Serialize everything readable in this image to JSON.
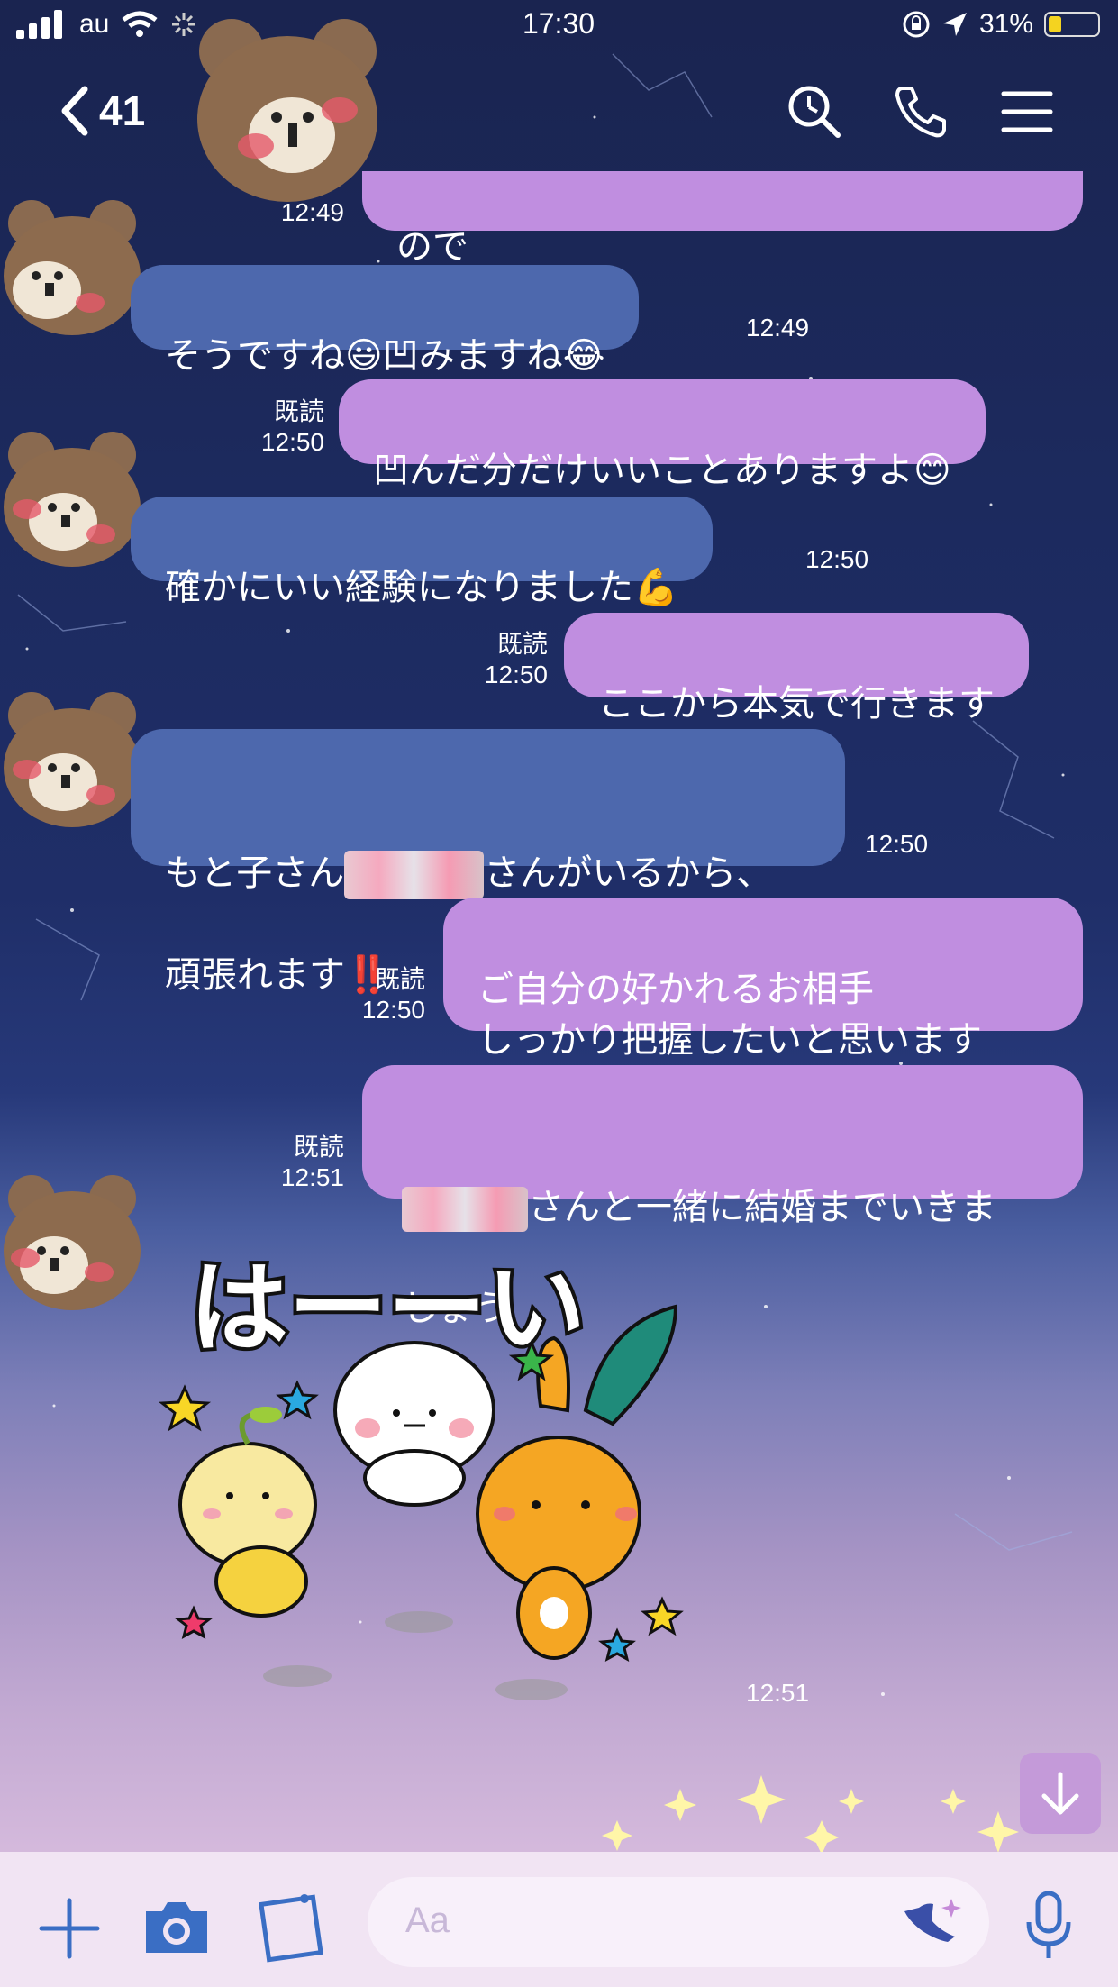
{
  "status_bar": {
    "carrier": "au",
    "time": "17:30",
    "battery": "31%"
  },
  "header": {
    "back_count": "41"
  },
  "messages": [
    {
      "side": "me",
      "text": "ので",
      "read": "",
      "time": "12:49"
    },
    {
      "side": "them",
      "text": "そうですね😃凹みますね😂",
      "time": "12:49"
    },
    {
      "side": "me",
      "text": "凹んだ分だけいいことありますよ😊",
      "read": "既読",
      "time": "12:50"
    },
    {
      "side": "them",
      "text": "確かにいい経験になりました💪",
      "time": "12:50"
    },
    {
      "side": "me",
      "text": "ここから本気で行きます",
      "read": "既読",
      "time": "12:50"
    },
    {
      "side": "them",
      "line1_a": "もと子さん",
      "line1_b": "さんがいるから、",
      "line2": "頑張れます‼️",
      "time": "12:50"
    },
    {
      "side": "me",
      "text": "ご自分の好かれるお相手\nしっかり把握したいと思います",
      "read": "既読",
      "time": "12:50"
    },
    {
      "side": "me",
      "line1_b": "さんと一緒に結婚までいきま",
      "line2": "しょう",
      "read": "既読",
      "time": "12:51"
    }
  ],
  "sticker": {
    "text": "はーーい",
    "time": "12:51"
  },
  "input": {
    "placeholder": "Aa"
  },
  "icons": [
    "back-icon",
    "search-icon",
    "phone-icon",
    "menu-icon",
    "plus-icon",
    "camera-icon",
    "album-icon",
    "effect-icon",
    "mic-icon",
    "scroll-down-icon"
  ],
  "colors": {
    "bubble_them": "#4d68ad",
    "bubble_me": "#c08ee0",
    "accent": "#3a6ec4"
  }
}
